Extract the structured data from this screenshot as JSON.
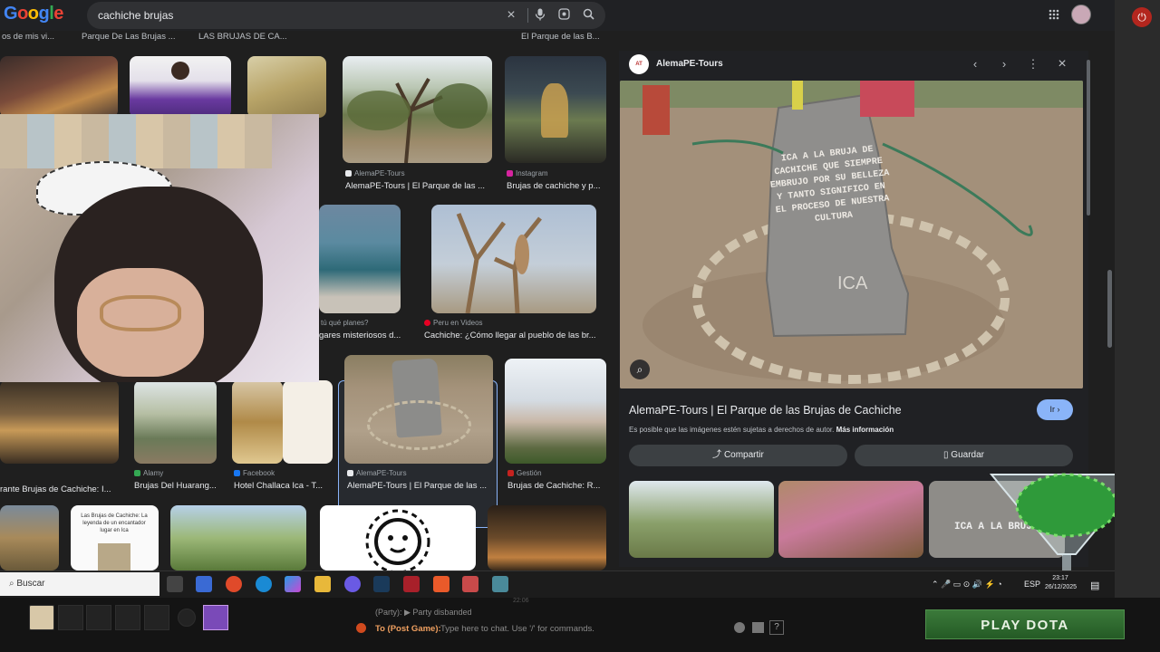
{
  "browser": {
    "logo_text": "Google",
    "search_query": "cachiche brujas"
  },
  "grid": {
    "top_row_captions": [
      "os de mis vi...",
      "Parque De Las Brujas ...",
      "LAS BRUJAS DE CA...",
      "El Parque de las B..."
    ],
    "row1": [
      {
        "source": "AlemaPE-Tours",
        "title": "AlemaPE-Tours | El Parque de las ..."
      },
      {
        "source": "Instagram",
        "title": "Brujas de cachiche y p..."
      }
    ],
    "row2": [
      {
        "source": "tú qué planes?",
        "title": "gares misteriosos d..."
      },
      {
        "source": "Peru en Videos",
        "title": "Cachiche: ¿Cómo llegar al pueblo de las br..."
      }
    ],
    "row3": [
      {
        "source": "eb",
        "title": "rante Brujas de Cachiche: I..."
      },
      {
        "source": "Alamy",
        "title": "Brujas Del Huarang..."
      },
      {
        "source": "Facebook",
        "title": "Hotel Challaca Ica - T..."
      },
      {
        "source": "AlemaPE-Tours",
        "title": "AlemaPE-Tours | El Parque de las ..."
      },
      {
        "source": "Gestión",
        "title": "Brujas de Cachiche: R..."
      }
    ],
    "doc_thumb_text": "Las Brujas de Cachiche: La leyenda de un encantador lugar en Ica"
  },
  "panel": {
    "source": "AlemaPE-Tours",
    "title": "AlemaPE-Tours | El Parque de las Brujas de Cachiche",
    "go_label": "Ir",
    "copyright_text": "Es posible que las imágenes estén sujetas a derechos de autor.",
    "more_info": "Más información",
    "share_label": "Compartir",
    "save_label": "Guardar",
    "stone_text": "ICA A LA BRUJA DE CACHICHE QUE SIEMPRE EMBRUJO POR SU BELLEZA Y TANTO SIGNIFICO EN EL PROCESO DE NUESTRA CULTURA",
    "stone_footer": "ICA",
    "related_stone_text": "ICA A LA BRUJA"
  },
  "taskbar": {
    "search_label": "Buscar",
    "language": "ESP",
    "time": "23:17",
    "date": "26/12/2025",
    "overlay_time": "22:06"
  },
  "game": {
    "party_message": "(Party): ▶ Party disbanded",
    "chat_channel": "To (Post Game):",
    "chat_placeholder": "Type here to chat. Use '/' for commands.",
    "play_button": "PLAY DOTA"
  }
}
